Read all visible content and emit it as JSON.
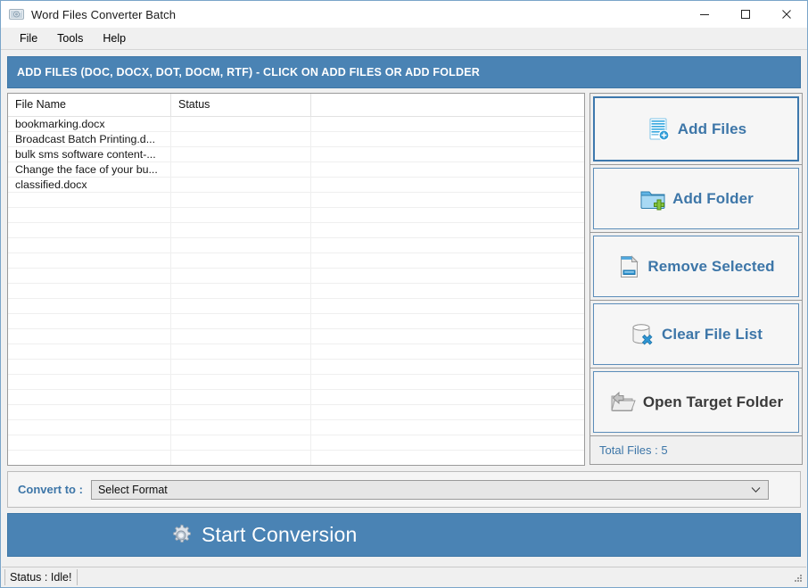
{
  "window": {
    "title": "Word Files Converter Batch",
    "app_icon": "camera-photo-icon",
    "minimize_icon": "minimize-icon",
    "maximize_icon": "maximize-icon",
    "close_icon": "close-icon"
  },
  "menubar": {
    "items": [
      {
        "label": "File"
      },
      {
        "label": "Tools"
      },
      {
        "label": "Help"
      }
    ]
  },
  "banner": {
    "text": "ADD FILES (DOC, DOCX, DOT, DOCM, RTF) - CLICK ON ADD FILES OR ADD FOLDER",
    "background": "#4a83b4",
    "color": "#ffffff"
  },
  "filelist": {
    "columns": [
      "File Name",
      "Status",
      ""
    ],
    "rows": [
      {
        "name": "bookmarking.docx",
        "status": "",
        "extra": ""
      },
      {
        "name": "Broadcast Batch Printing.d...",
        "status": "",
        "extra": ""
      },
      {
        "name": "bulk sms software content-...",
        "status": "",
        "extra": ""
      },
      {
        "name": "Change the face of your bu...",
        "status": "",
        "extra": ""
      },
      {
        "name": "classified.docx",
        "status": "",
        "extra": ""
      }
    ],
    "empty_row_count": 19
  },
  "actions": {
    "add_files": {
      "label": "Add Files",
      "icon": "add-files-icon",
      "focused": true
    },
    "add_folder": {
      "label": "Add Folder",
      "icon": "add-folder-icon"
    },
    "remove_selected": {
      "label": "Remove Selected",
      "icon": "remove-file-icon"
    },
    "clear_file_list": {
      "label": "Clear File List",
      "icon": "clear-database-icon"
    },
    "open_target_folder": {
      "label": "Open Target Folder",
      "icon": "open-folder-icon"
    },
    "total_files": "Total Files : 5"
  },
  "convert": {
    "label": "Convert to :",
    "selected": "Select Format",
    "placeholder": "Select Format",
    "dropdown_icon": "chevron-down-icon"
  },
  "start": {
    "label": "Start Conversion",
    "icon": "gear-icon",
    "background": "#4a83b4"
  },
  "statusbar": {
    "text": "Status  :  Idle!",
    "grip_icon": "resize-grip-icon"
  },
  "theme": {
    "accent": "#4a83b4",
    "link_blue": "#3d76a8",
    "window_border": "#7aa5c9"
  }
}
